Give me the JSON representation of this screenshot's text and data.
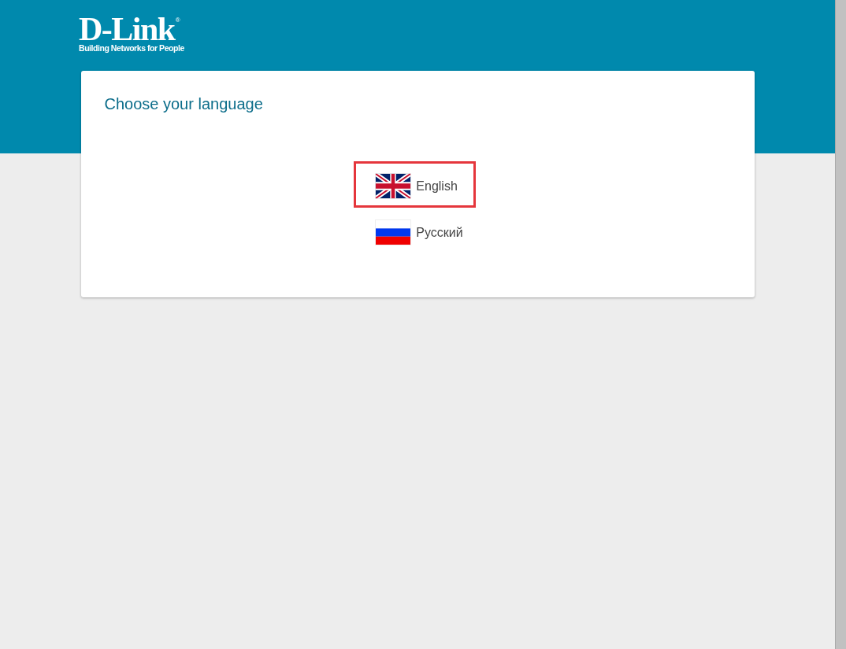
{
  "header": {
    "logo": {
      "wordmark": "D-Link",
      "registered": "®",
      "tagline": "Building Networks for People"
    }
  },
  "card": {
    "title": "Choose your language",
    "languages": [
      {
        "label": "English",
        "kind": "uk",
        "selected": true
      },
      {
        "label": "Русский",
        "kind": "ru",
        "selected": false
      }
    ]
  }
}
